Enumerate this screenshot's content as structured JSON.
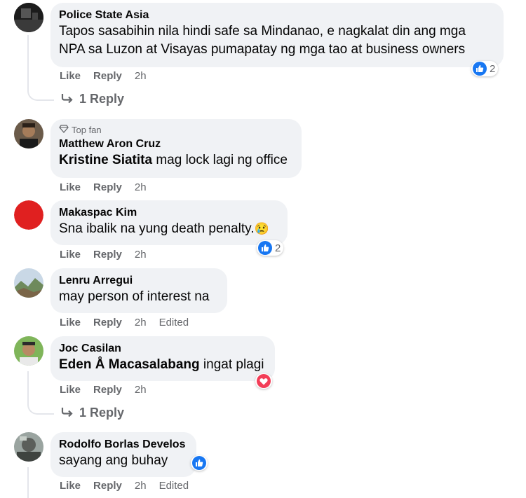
{
  "comments": [
    {
      "author": "Police State Asia",
      "text": "Tapos sasabihin nila hindi safe sa Mindanao, e nagkalat din ang mga",
      "text2": "NPA sa Luzon at Visayas pumapatay ng mga tao at business owners",
      "like": "Like",
      "reply": "Reply",
      "time": "2h",
      "reaction": {
        "type": "like",
        "count": "2"
      },
      "replies": "1 Reply"
    },
    {
      "badge": "Top fan",
      "author": "Matthew Aron Cruz",
      "mention": "Kristine Siatita",
      "text": "mag lock lagi ng office",
      "like": "Like",
      "reply": "Reply",
      "time": "2h"
    },
    {
      "author": "Makaspac Kim",
      "text": "Sna ibalik na yung death penalty.",
      "emoji": "😢",
      "like": "Like",
      "reply": "Reply",
      "time": "2h",
      "reaction": {
        "type": "like",
        "count": "2"
      }
    },
    {
      "author": "Lenru Arregui",
      "text": "may person of interest na",
      "like": "Like",
      "reply": "Reply",
      "time": "2h",
      "edited": "Edited"
    },
    {
      "author": "Joc Casilan",
      "mention": "Eden Å Macasalabang",
      "text": "ingat plagi",
      "like": "Like",
      "reply": "Reply",
      "time": "2h",
      "reaction": {
        "type": "love"
      },
      "replies": "1 Reply"
    },
    {
      "author": "Rodolfo Borlas Develos",
      "text": "sayang ang buhay",
      "like": "Like",
      "reply": "Reply",
      "time": "2h",
      "edited": "Edited",
      "reaction": {
        "type": "like"
      }
    }
  ],
  "colors": {
    "like_blue": "#1877f2",
    "love_red": "#f33e58",
    "bubble": "#f0f2f5",
    "meta": "#65676b"
  }
}
